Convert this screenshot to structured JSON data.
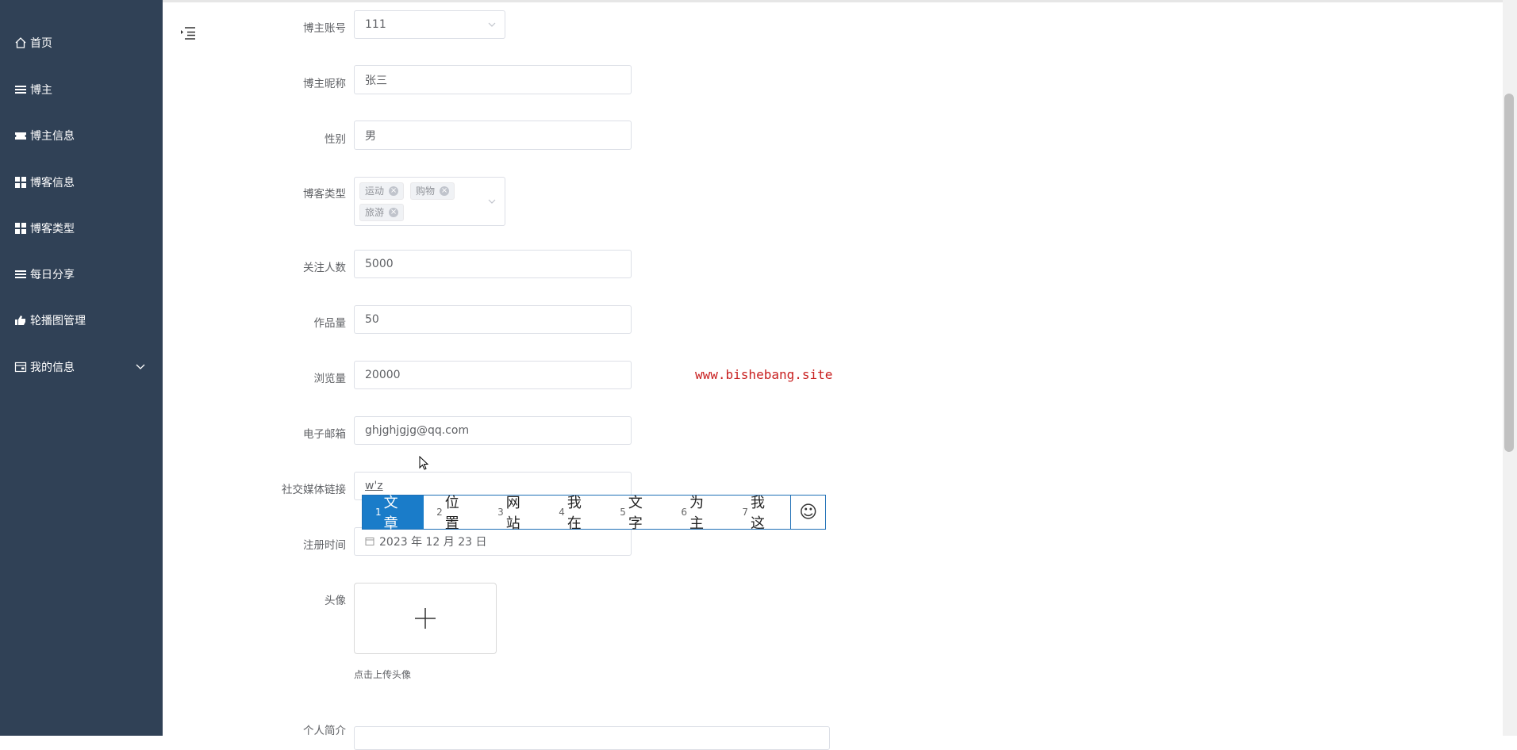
{
  "sidebar": {
    "items": [
      {
        "label": "首页",
        "icon": "home-icon"
      },
      {
        "label": "博主",
        "icon": "list-icon"
      },
      {
        "label": "博主信息",
        "icon": "ticket-icon"
      },
      {
        "label": "博客信息",
        "icon": "grid-icon"
      },
      {
        "label": "博客类型",
        "icon": "grid-icon"
      },
      {
        "label": "每日分享",
        "icon": "list-icon"
      },
      {
        "label": "轮播图管理",
        "icon": "thumb-icon"
      },
      {
        "label": "我的信息",
        "icon": "card-icon"
      }
    ]
  },
  "form": {
    "account_label": "博主账号",
    "account_value": "111",
    "nickname_label": "博主昵称",
    "nickname_value": "张三",
    "gender_label": "性别",
    "gender_value": "男",
    "blog_type_label": "博客类型",
    "blog_type_tags": [
      "运动",
      "购物",
      "旅游"
    ],
    "followers_label": "关注人数",
    "followers_value": "5000",
    "works_label": "作品量",
    "works_value": "50",
    "views_label": "浏览量",
    "views_value": "20000",
    "email_label": "电子邮箱",
    "email_value": "ghjghjgjg@qq.com",
    "social_label": "社交媒体链接",
    "social_value": "w'z",
    "register_label": "注册时间",
    "register_value": "2023 年 12 月 23 日",
    "avatar_label": "头像",
    "avatar_hint": "点击上传头像",
    "bio_label": "个人简介"
  },
  "ime": {
    "candidates": [
      {
        "n": "1",
        "text": "文章"
      },
      {
        "n": "2",
        "text": "位置"
      },
      {
        "n": "3",
        "text": "网站"
      },
      {
        "n": "4",
        "text": "我在"
      },
      {
        "n": "5",
        "text": "文字"
      },
      {
        "n": "6",
        "text": "为主"
      },
      {
        "n": "7",
        "text": "我这"
      }
    ],
    "emoji": "☺"
  },
  "watermark": "www.bishebang.site",
  "colors": {
    "sidebar_bg": "#304156",
    "ime_selected": "#1a7cc9",
    "watermark": "#c81f1f"
  }
}
